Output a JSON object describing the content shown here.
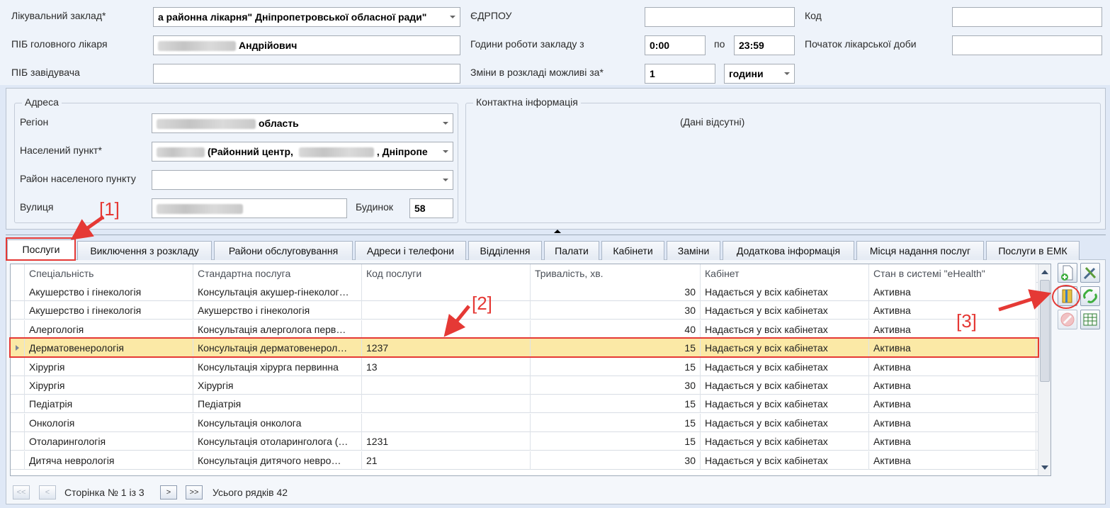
{
  "form": {
    "facility_label": "Лікувальний заклад*",
    "facility_value": "а районна лікарня\" Дніпропетровської обласної ради\"",
    "edrpou_label": "ЄДРПОУ",
    "edrpou_value": "",
    "code_label": "Код",
    "code_value": "",
    "chief_label": "ПІБ головного лікаря",
    "chief_value": "Андрійович",
    "hours_label": "Години роботи закладу з",
    "hours_from": "0:00",
    "hours_to_label": "по",
    "hours_to": "23:59",
    "day_start_label": "Початок лікарської доби",
    "day_start_value": "",
    "head_label": "ПІБ завідувача",
    "head_value": "",
    "changes_label": "Зміни в розкладі можливі за*",
    "changes_value": "1",
    "changes_unit": "години"
  },
  "address": {
    "title": "Адреса",
    "region_label": "Регіон",
    "region_value": "область",
    "locality_label": "Населений пункт*",
    "locality_value_1": "(Районний центр,",
    "locality_value_2": ", Дніпропе",
    "district_label": "Район населеного пункту",
    "district_value": "",
    "street_label": "Вулиця",
    "building_label": "Будинок",
    "building_value": "58"
  },
  "contact": {
    "title": "Контактна інформація",
    "empty_text": "(Дані відсутні)"
  },
  "tabs": [
    {
      "label": "Послуги"
    },
    {
      "label": "Виключення з розкладу"
    },
    {
      "label": "Райони обслуговування"
    },
    {
      "label": "Адреси і телефони"
    },
    {
      "label": "Відділення"
    },
    {
      "label": "Палати"
    },
    {
      "label": "Кабінети"
    },
    {
      "label": "Заміни"
    },
    {
      "label": "Додаткова інформація"
    },
    {
      "label": "Місця надання послуг"
    },
    {
      "label": "Послуги в ЕМК"
    }
  ],
  "grid": {
    "columns": [
      "Спеціальність",
      "Стандартна послуга",
      "Код послуги",
      "Тривалість, хв.",
      "Кабінет",
      "Стан в системі \"eHealth\""
    ],
    "rows": [
      [
        "Акушерство і гінекологія",
        "Консультація акушер-гінеколог…",
        "",
        "30",
        "Надається у всіх кабінетах",
        "Активна"
      ],
      [
        "Акушерство і гінекологія",
        "Акушерство і гінекологія",
        "",
        "30",
        "Надається у всіх кабінетах",
        "Активна"
      ],
      [
        "Алергологія",
        "Консультація алерголога перв…",
        "",
        "40",
        "Надається у всіх кабінетах",
        "Активна"
      ],
      [
        "Дерматовенерологія",
        "Консультація дерматовенерол…",
        "1237",
        "15",
        "Надається у всіх кабінетах",
        "Активна"
      ],
      [
        "Хірургія",
        "Консультація хірурга первинна",
        "13",
        "15",
        "Надається у всіх кабінетах",
        "Активна"
      ],
      [
        "Хірургія",
        "Хірургія",
        "",
        "30",
        "Надається у всіх кабінетах",
        "Активна"
      ],
      [
        "Педіатрія",
        "Педіатрія",
        "",
        "15",
        "Надається у всіх кабінетах",
        "Активна"
      ],
      [
        "Онкологія",
        "Консультація онколога",
        "",
        "15",
        "Надається у всіх кабінетах",
        "Активна"
      ],
      [
        "Отоларингологія",
        "Консультація отоларинголога (…",
        "1231",
        "15",
        "Надається у всіх кабінетах",
        "Активна"
      ],
      [
        "Дитяча неврологія",
        "Консультація  дитячого невро…",
        "21",
        "30",
        "Надається у всіх кабінетах",
        "Активна"
      ]
    ]
  },
  "pager": {
    "first": "<<",
    "prev": "<",
    "page_text": "Сторінка № 1 із 3",
    "next": ">",
    "last": ">>",
    "total_text": "Усього рядків 42"
  },
  "annotations": {
    "a1": "[1]",
    "a2": "[2]",
    "a3": "[3]"
  },
  "colors": {
    "selection": "#fbe9a6",
    "annotation": "#e53935",
    "background": "#dfe8f6"
  },
  "icons": [
    "add-document-icon",
    "tools-icon",
    "bookmark-edit-icon",
    "link-icon",
    "cancel-icon",
    "table-icon"
  ]
}
